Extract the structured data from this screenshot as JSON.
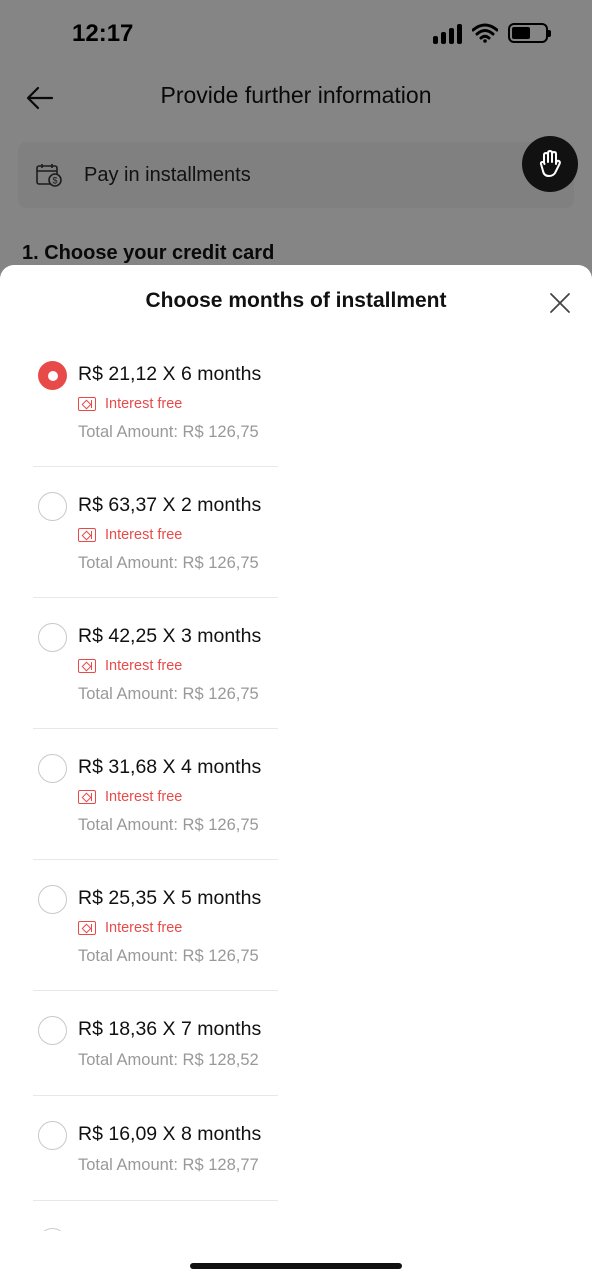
{
  "status_bar": {
    "time": "12:17"
  },
  "nav": {
    "title": "Provide further information"
  },
  "payment": {
    "label": "Pay in installments"
  },
  "section": {
    "heading": "1. Choose your credit card"
  },
  "sheet": {
    "title": "Choose months of installment",
    "options": [
      {
        "main": "R$ 21,12 X 6 months",
        "tag": "Interest free",
        "total": "Total Amount: R$ 126,75",
        "selected": true
      },
      {
        "main": "R$ 63,37 X 2 months",
        "tag": "Interest free",
        "total": "Total Amount: R$ 126,75",
        "selected": false
      },
      {
        "main": "R$ 42,25 X 3 months",
        "tag": "Interest free",
        "total": "Total Amount: R$ 126,75",
        "selected": false
      },
      {
        "main": "R$ 31,68 X 4 months",
        "tag": "Interest free",
        "total": "Total Amount: R$ 126,75",
        "selected": false
      },
      {
        "main": "R$ 25,35 X 5 months",
        "tag": "Interest free",
        "total": "Total Amount: R$ 126,75",
        "selected": false
      },
      {
        "main": "R$ 18,36 X 7 months",
        "tag": "",
        "total": "Total Amount: R$ 128,52",
        "selected": false
      },
      {
        "main": "R$ 16,09 X 8 months",
        "tag": "",
        "total": "Total Amount: R$ 128,77",
        "selected": false
      }
    ]
  },
  "colors": {
    "accent": "#e84a4a",
    "muted_text": "#999999"
  },
  "icons": {
    "back": "arrow-left-icon",
    "payment": "calendar-dollar-icon",
    "fab": "hand-icon",
    "close": "close-icon",
    "tag": "coupon-icon"
  }
}
